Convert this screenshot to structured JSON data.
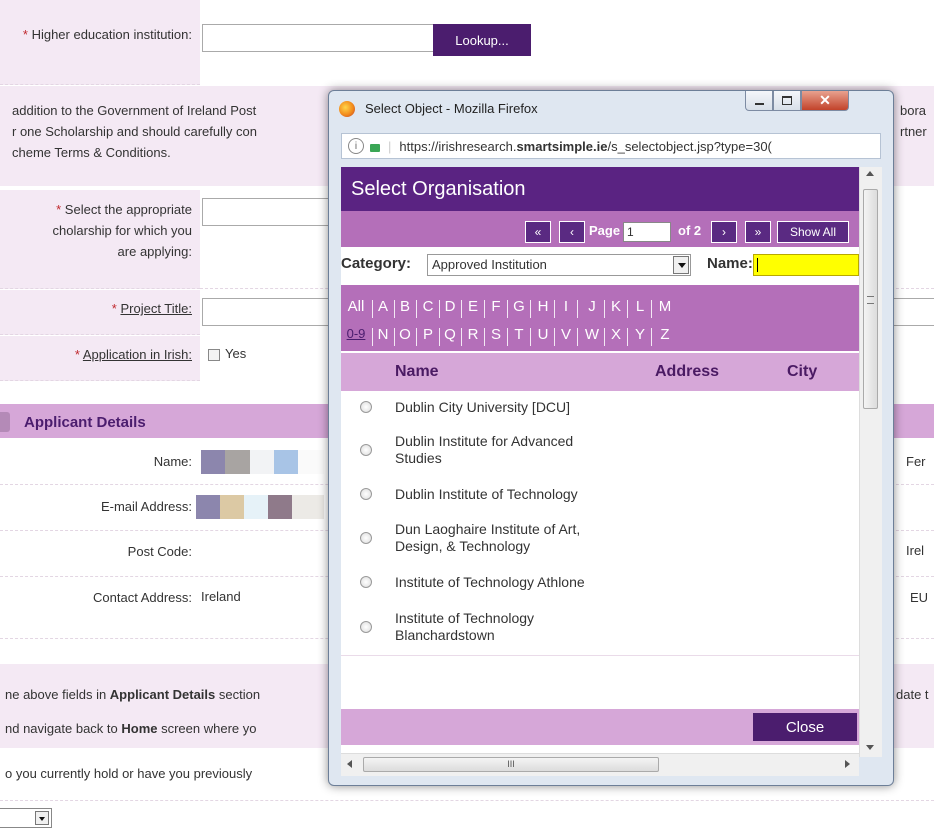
{
  "form": {
    "higher_ed_label": "Higher education institution:",
    "lookup_button": "Lookup...",
    "intro_lines": [
      "addition to the Government of Ireland Post",
      "r one Scholarship and should carefully con",
      "cheme Terms & Conditions."
    ],
    "right_fragments": [
      "bora",
      "rtner"
    ],
    "scholarship_label_lines": [
      "Select the appropriate",
      "cholarship for which you",
      "are applying:"
    ],
    "project_title_label": "Project Title:",
    "application_irish_label": "Application in Irish:",
    "yes_label": "Yes",
    "applicant_section_title": "Applicant Details",
    "name_label": "Name:",
    "email_label": "E-mail Address:",
    "postcode_label": "Post Code:",
    "contact_address_label": "Contact Address:",
    "contact_address_value": "Ireland",
    "right_values": [
      "Fer",
      "Irel",
      "EU"
    ],
    "note_line1_pre": "ne above fields in ",
    "note_line1_bold": "Applicant Details",
    "note_line1_post": " section",
    "note_line1_right": "date t",
    "note_line2_pre": "nd navigate back to ",
    "note_line2_bold": "Home",
    "note_line2_post": " screen where yo",
    "question_line": "o you currently hold or have you previously",
    "required_mark": "*"
  },
  "popup": {
    "window_title": "Select Object - Mozilla Firefox",
    "url_pre": "https://irishresearch.",
    "url_bold": "smartsimple.ie",
    "url_post": "/s_selectobject.jsp?type=30(",
    "header_title": "Select Organisation",
    "pager": {
      "first": "«",
      "prev": "‹",
      "page_label": "Page",
      "page_value": "1",
      "of_label": "of 2",
      "next": "›",
      "last": "»",
      "show_all": "Show All"
    },
    "category_label": "Category:",
    "category_value": "Approved Institution",
    "name_label": "Name:",
    "alphabet_row1": [
      "All",
      "A",
      "B",
      "C",
      "D",
      "E",
      "F",
      "G",
      "H",
      "I",
      "J",
      "K",
      "L",
      "M"
    ],
    "alphabet_row2": [
      "0-9",
      "N",
      "O",
      "P",
      "Q",
      "R",
      "S",
      "T",
      "U",
      "V",
      "W",
      "X",
      "Y",
      "Z"
    ],
    "columns": [
      "Name",
      "Address",
      "City"
    ],
    "rows": [
      [
        "Dublin City University [DCU]"
      ],
      [
        "Dublin Institute for Advanced",
        "Studies"
      ],
      [
        "Dublin Institute of Technology"
      ],
      [
        "Dun Laoghaire Institute of Art,",
        "Design, & Technology"
      ],
      [
        "Institute of Technology Athlone"
      ],
      [
        "Institute of Technology",
        "Blanchardstown"
      ]
    ],
    "close_button": "Close",
    "hscroll_grip": "III"
  },
  "colors": {
    "purple_dark": "#4b1d6e",
    "purple_header": "#5a2382",
    "purple_mid": "#b46fb9",
    "lavender": "#d6a7d8",
    "pink_bg": "#f4e9f4",
    "name_highlight": "#ffff00"
  }
}
